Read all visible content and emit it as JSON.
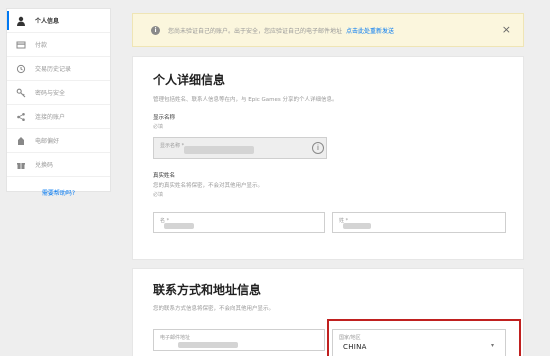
{
  "sidebar": {
    "items": [
      {
        "label": "个人信息",
        "icon": "user-icon",
        "active": true
      },
      {
        "label": "付款",
        "icon": "card-icon"
      },
      {
        "label": "交易历史记录",
        "icon": "history-icon"
      },
      {
        "label": "密码与安全",
        "icon": "key-icon"
      },
      {
        "label": "连接的账户",
        "icon": "share-icon"
      },
      {
        "label": "电邮偏好",
        "icon": "mail-icon"
      },
      {
        "label": "兑换码",
        "icon": "gift-icon"
      }
    ],
    "bottom_link": "需要帮助吗?"
  },
  "alert": {
    "icon": "info-icon",
    "message": "您尚未验证自己的账户。出于安全，您应验证自己的电子邮件地址",
    "resend": "点击此处重新发送",
    "close": "×"
  },
  "personal": {
    "title": "个人详细信息",
    "description": "管理包括姓名、联系人信息等在内，与 Epic Games 分享的个人详细信息。",
    "display_name_label": "显示名称",
    "display_name_req": "必填",
    "display_name_placeholder": "显示名称 *",
    "info_icon": "i",
    "real_name_label": "真实姓名",
    "real_name_desc": "您的真实姓名将保密，不会对其他用户显示。",
    "real_name_req": "必填",
    "first_name_placeholder": "名 *",
    "last_name_placeholder": "姓 *"
  },
  "contact": {
    "title": "联系方式和地址信息",
    "description": "您的联系方式信息将保密，不会向其他用户显示。",
    "email_placeholder": "电子邮件地址",
    "country_placeholder": "国家/地区",
    "country_value": "CHINA",
    "dropdown_icon": "▾"
  },
  "colors": {
    "accent": "#0078f2",
    "alert_bg": "#fbf6dd",
    "highlight": "#c0201f"
  }
}
